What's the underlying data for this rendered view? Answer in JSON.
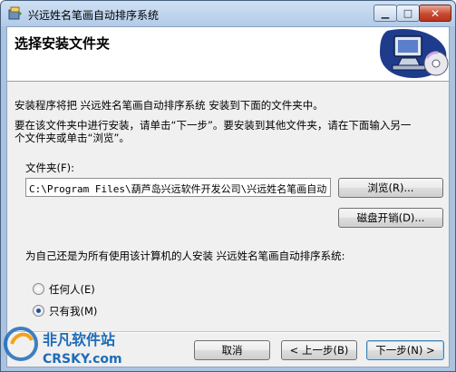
{
  "window": {
    "title": "兴远姓名笔画自动排序系统",
    "controls": {
      "minimize": "▁",
      "maximize": "□",
      "close": "✕"
    }
  },
  "banner": {
    "title": "选择安装文件夹"
  },
  "body": {
    "line1": "安装程序将把 兴远姓名笔画自动排序系统 安装到下面的文件夹中。",
    "line2": "要在该文件夹中进行安装，请单击“下一步”。要安装到其他文件夹，请在下面输入另一",
    "line3": "个文件夹或单击“浏览”。",
    "folder_label": "文件夹(F):",
    "folder_value": "C:\\Program Files\\葫芦岛兴远软件开发公司\\兴远姓名笔画自动",
    "browse_button": "浏览(R)...",
    "disk_cost_button": "磁盘开销(D)...",
    "install_for_question": "为自己还是为所有使用该计算机的人安装 兴远姓名笔画自动排序系统:",
    "options": [
      {
        "label": "任何人(E)",
        "checked": false
      },
      {
        "label": "只有我(M)",
        "checked": true
      }
    ]
  },
  "footer": {
    "cancel": "取消",
    "back": "< 上一步(B)",
    "next": "下一步(N) >"
  },
  "watermark": {
    "name": "非凡软件站",
    "site": "CRSKY.com"
  },
  "colors": {
    "frame": "#a9c3e0",
    "client_bg": "#f0f0f0",
    "close_button": "#c74a2e",
    "watermark": "#1e6bb8"
  }
}
